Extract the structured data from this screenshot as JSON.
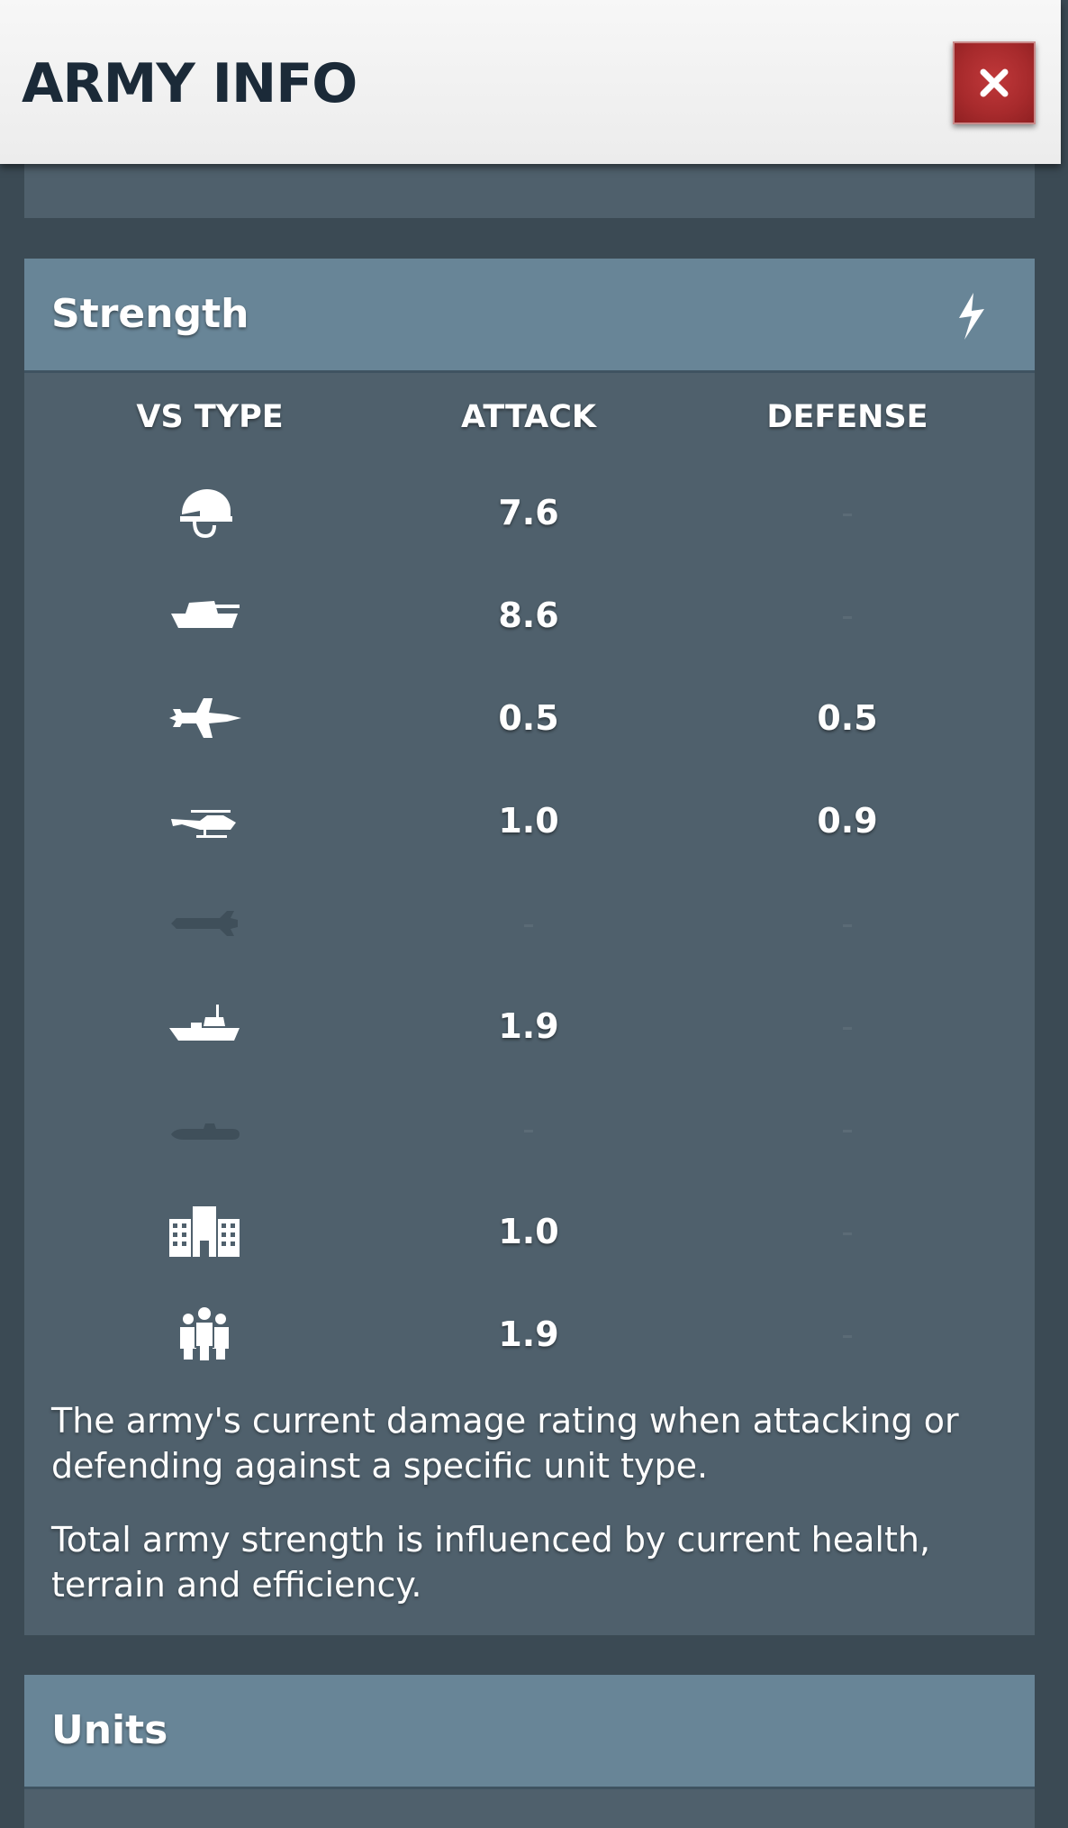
{
  "header": {
    "title": "ARMY INFO",
    "close_label": "×"
  },
  "strength": {
    "title": "Strength",
    "columns": {
      "type": "VS TYPE",
      "attack": "ATTACK",
      "defense": "DEFENSE"
    },
    "rows": [
      {
        "icon": "infantry-helmet-icon",
        "attack": "7.6",
        "defense": "-"
      },
      {
        "icon": "tank-icon",
        "attack": "8.6",
        "defense": "-"
      },
      {
        "icon": "jet-fighter-icon",
        "attack": "0.5",
        "defense": "0.5"
      },
      {
        "icon": "helicopter-icon",
        "attack": "1.0",
        "defense": "0.9"
      },
      {
        "icon": "missile-icon",
        "attack": "-",
        "defense": "-"
      },
      {
        "icon": "ship-icon",
        "attack": "1.9",
        "defense": "-"
      },
      {
        "icon": "submarine-icon",
        "attack": "-",
        "defense": "-"
      },
      {
        "icon": "building-icon",
        "attack": "1.0",
        "defense": "-"
      },
      {
        "icon": "civilians-icon",
        "attack": "1.9",
        "defense": "-"
      }
    ],
    "description": [
      "The army's current damage rating when attacking or defending against a specific unit type.",
      "Total army strength is influenced by current health, terrain and efficiency."
    ]
  },
  "units": {
    "title": "Units"
  },
  "colors": {
    "background": "#3b4a54",
    "card": "#4f606c",
    "card_header": "#688597",
    "close_button": "#a72a2c",
    "title_text": "#1b2a38"
  }
}
